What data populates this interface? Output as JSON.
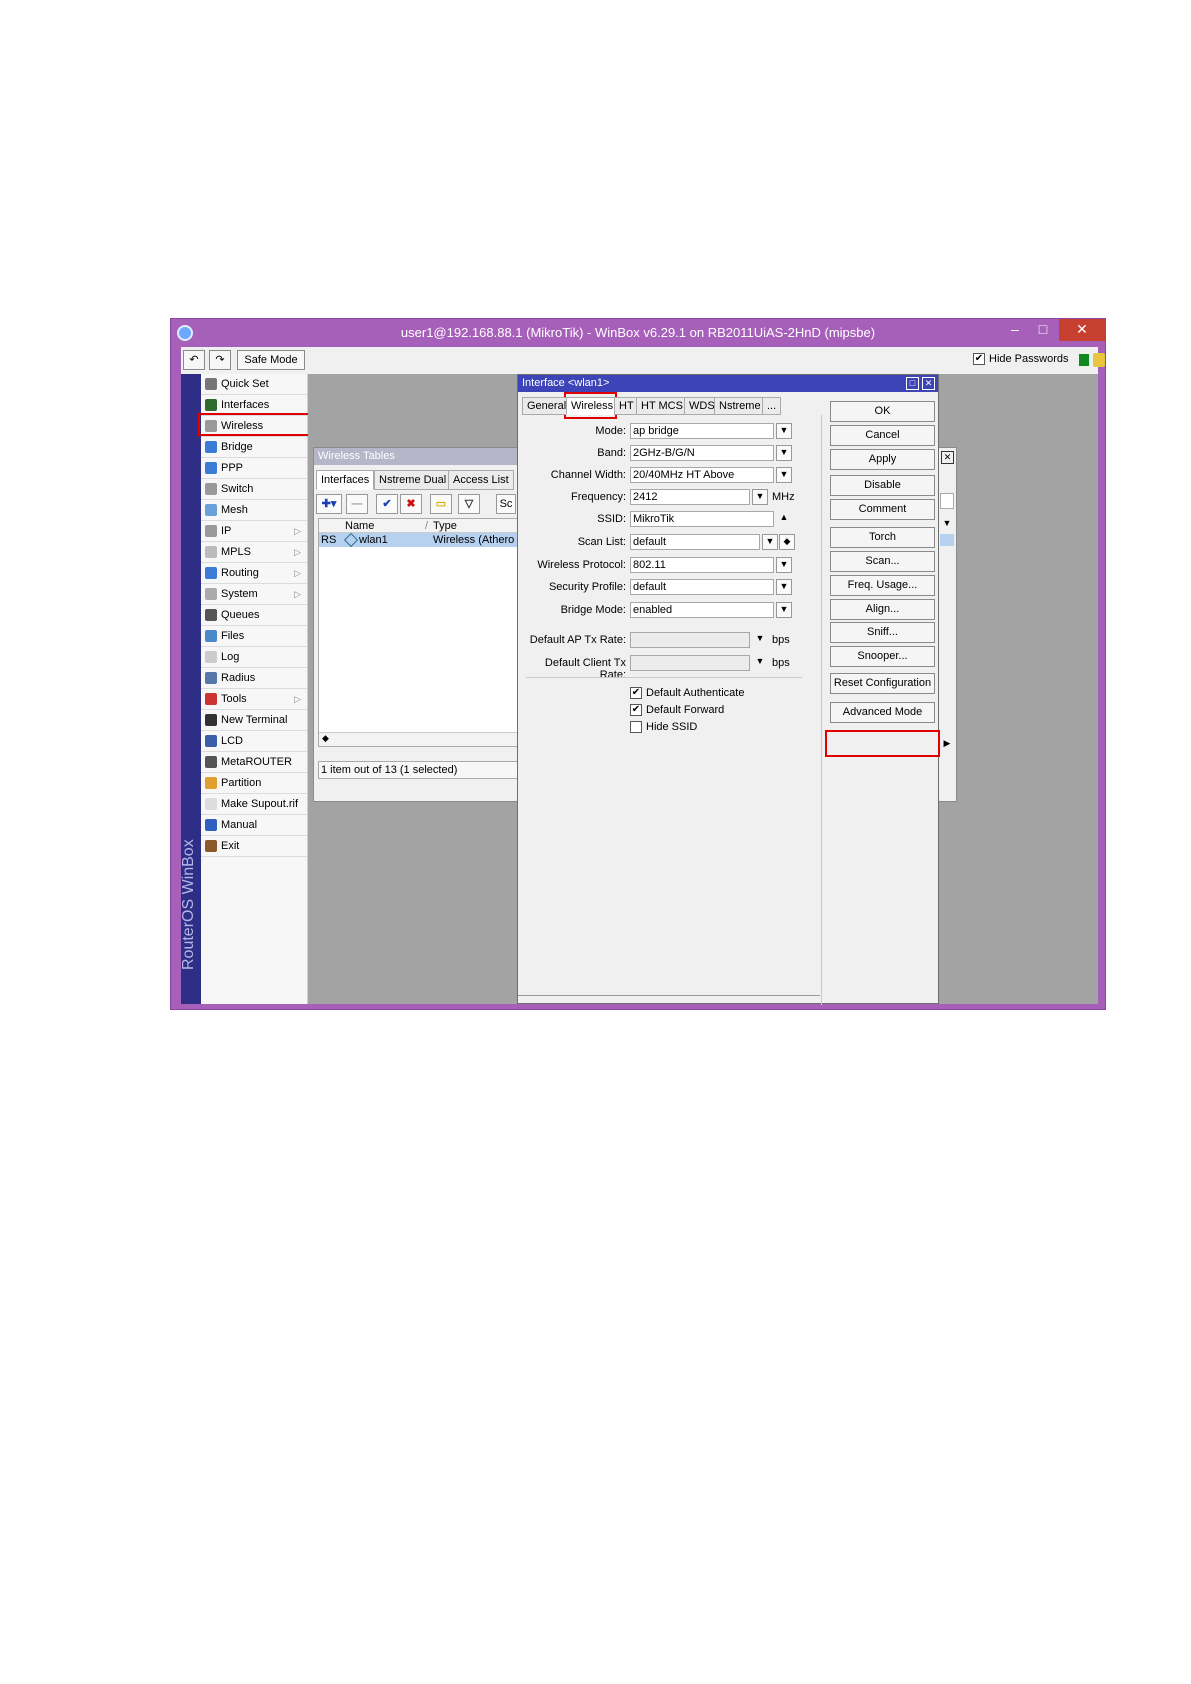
{
  "window": {
    "title": "user1@192.168.88.1 (MikroTik) - WinBox v6.29.1 on RB2011UiAS-2HnD (mipsbe)",
    "minimize": "–",
    "maximize": "□",
    "close": "✕"
  },
  "toolbar": {
    "undo": "↶",
    "redo": "↷",
    "safe_mode": "Safe Mode",
    "hide_passwords": "Hide Passwords",
    "hide_passwords_checked": "✔"
  },
  "vertical_label": "RouterOS WinBox",
  "menu": [
    {
      "label": "Quick Set",
      "icon": "quick-set-icon",
      "color": "#777777",
      "arrow": ""
    },
    {
      "label": "Interfaces",
      "icon": "interfaces-icon",
      "color": "#2e6b2e",
      "arrow": ""
    },
    {
      "label": "Wireless",
      "icon": "wireless-icon",
      "color": "#999999",
      "arrow": ""
    },
    {
      "label": "Bridge",
      "icon": "bridge-icon",
      "color": "#3a7bd5",
      "arrow": ""
    },
    {
      "label": "PPP",
      "icon": "ppp-icon",
      "color": "#3a7bd5",
      "arrow": ""
    },
    {
      "label": "Switch",
      "icon": "switch-icon",
      "color": "#999999",
      "arrow": ""
    },
    {
      "label": "Mesh",
      "icon": "mesh-icon",
      "color": "#6aa0d8",
      "arrow": ""
    },
    {
      "label": "IP",
      "icon": "ip-icon",
      "color": "#999999",
      "arrow": "▷"
    },
    {
      "label": "MPLS",
      "icon": "mpls-icon",
      "color": "#bbbbbb",
      "arrow": "▷"
    },
    {
      "label": "Routing",
      "icon": "routing-icon",
      "color": "#3a7bd5",
      "arrow": "▷"
    },
    {
      "label": "System",
      "icon": "system-icon",
      "color": "#aaaaaa",
      "arrow": "▷"
    },
    {
      "label": "Queues",
      "icon": "queues-icon",
      "color": "#555555",
      "arrow": ""
    },
    {
      "label": "Files",
      "icon": "files-icon",
      "color": "#4a89c8",
      "arrow": ""
    },
    {
      "label": "Log",
      "icon": "log-icon",
      "color": "#cccccc",
      "arrow": ""
    },
    {
      "label": "Radius",
      "icon": "radius-icon",
      "color": "#5577aa",
      "arrow": ""
    },
    {
      "label": "Tools",
      "icon": "tools-icon",
      "color": "#cc3333",
      "arrow": "▷"
    },
    {
      "label": "New Terminal",
      "icon": "terminal-icon",
      "color": "#333333",
      "arrow": ""
    },
    {
      "label": "LCD",
      "icon": "lcd-icon",
      "color": "#3a5fa8",
      "arrow": ""
    },
    {
      "label": "MetaROUTER",
      "icon": "metarouter-icon",
      "color": "#555555",
      "arrow": ""
    },
    {
      "label": "Partition",
      "icon": "partition-icon",
      "color": "#e0a030",
      "arrow": ""
    },
    {
      "label": "Make Supout.rif",
      "icon": "supout-icon",
      "color": "#dddddd",
      "arrow": ""
    },
    {
      "label": "Manual",
      "icon": "manual-icon",
      "color": "#2f5fbf",
      "arrow": ""
    },
    {
      "label": "Exit",
      "icon": "exit-icon",
      "color": "#8a5a2a",
      "arrow": ""
    }
  ],
  "wireless_tables": {
    "title": "Wireless Tables",
    "tabs": [
      "Interfaces",
      "Nstreme Dual",
      "Access List"
    ],
    "toolbar_icons": [
      {
        "name": "add-icon",
        "glyph": "✚▾",
        "color": "#1c3fb0"
      },
      {
        "name": "remove-icon",
        "glyph": "—",
        "color": "#999999"
      },
      {
        "name": "enable-icon",
        "glyph": "✔",
        "color": "#1c3fb0"
      },
      {
        "name": "disable-icon",
        "glyph": "✖",
        "color": "#cc1111"
      },
      {
        "name": "comment-icon",
        "glyph": "▭",
        "color": "#d9b300"
      },
      {
        "name": "filter-icon",
        "glyph": "▽",
        "color": "#333333"
      }
    ],
    "partial_button": "Sc",
    "columns": [
      "Name",
      "Type"
    ],
    "col_arrow": "/",
    "row": {
      "flags": "RS",
      "name": "wlan1",
      "type": "Wireless (Athero"
    },
    "scroll_left": "◆",
    "status": "1 item out of 13 (1 selected)"
  },
  "dialog": {
    "title": "Interface <wlan1>",
    "restore": "□",
    "close": "✕",
    "tabs": [
      "General",
      "Wireless",
      "HT",
      "HT MCS",
      "WDS",
      "Nstreme",
      "..."
    ],
    "fields": [
      {
        "label": "Mode:",
        "value": "ap bridge"
      },
      {
        "label": "Band:",
        "value": "2GHz-B/G/N"
      },
      {
        "label": "Channel Width:",
        "value": "20/40MHz HT Above"
      },
      {
        "label": "Frequency:",
        "value": "2412",
        "unit": "MHz"
      },
      {
        "label": "SSID:",
        "value": "MikroTik"
      },
      {
        "label": "Scan List:",
        "value": "default"
      },
      {
        "label": "Wireless Protocol:",
        "value": "802.11"
      },
      {
        "label": "Security Profile:",
        "value": "default"
      },
      {
        "label": "Bridge Mode:",
        "value": "enabled"
      },
      {
        "label": "Default AP Tx Rate:",
        "value": "",
        "unit": "bps"
      },
      {
        "label": "Default Client Tx Rate:",
        "value": "",
        "unit": "bps"
      }
    ],
    "checkboxes": [
      {
        "label": "Default Authenticate",
        "mark": "✔"
      },
      {
        "label": "Default Forward",
        "mark": "✔"
      },
      {
        "label": "Hide SSID",
        "mark": ""
      }
    ],
    "buttons": [
      "OK",
      "Cancel",
      "Apply",
      "Disable",
      "Comment",
      "Torch",
      "Scan...",
      "Freq. Usage...",
      "Align...",
      "Sniff...",
      "Snooper...",
      "Reset Configuration",
      "Advanced Mode"
    ]
  },
  "colors": {
    "window_frame": "#a760b9",
    "dialog_title": "#3c44b8",
    "highlight": "#e00000"
  }
}
